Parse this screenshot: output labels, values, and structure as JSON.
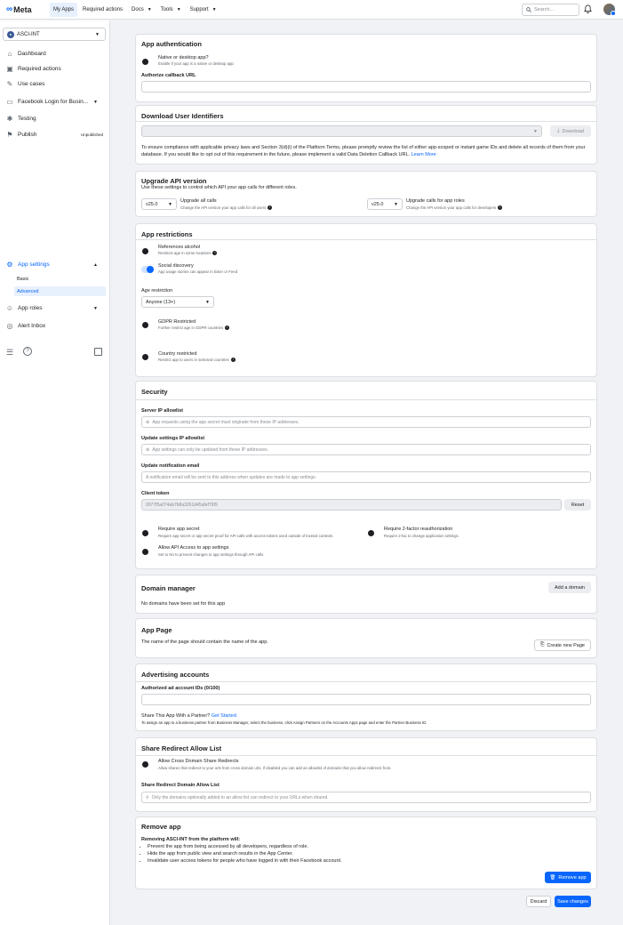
{
  "topbar": {
    "brand": "Meta",
    "nav": [
      {
        "label": "My Apps",
        "active": true,
        "caret": false
      },
      {
        "label": "Required actions",
        "active": false,
        "caret": false
      },
      {
        "label": "Docs",
        "active": false,
        "caret": true
      },
      {
        "label": "Tools",
        "active": false,
        "caret": true
      },
      {
        "label": "Support",
        "active": false,
        "caret": true
      }
    ],
    "search_placeholder": "Search..."
  },
  "sidebar": {
    "app_name": "ASCI-INT",
    "items": {
      "dashboard": "Dashboard",
      "required_actions": "Required actions",
      "use_cases": "Use cases",
      "facebook_login": "Facebook Login for Busin...",
      "testing": "Testing",
      "publish": "Publish",
      "publish_badge": "Unpublished",
      "app_settings": "App settings",
      "basic": "Basic",
      "advanced": "Advanced",
      "app_roles": "App roles",
      "alert_inbox": "Alert Inbox"
    }
  },
  "app_auth": {
    "title": "App authentication",
    "native_label": "Native or desktop app?",
    "native_sub": "Enable if your app is a native or desktop app",
    "callback_label": "Authorize callback URL"
  },
  "download_ids": {
    "title": "Download User Identifiers",
    "button": "Download",
    "text": "To ensure compliance with applicable privacy laws and Section 3(d)(i) of the Platform Terms, please promptly review the list of either app-scoped or instant game IDs and delete all records of them from your database. If you would like to opt out of this requirement in the future, please implement a valid Data Deletion Callback URL.",
    "learn_more": "Learn More"
  },
  "api_version": {
    "title": "Upgrade API version",
    "subtitle": "Use these settings to control which API your app calls for different roles.",
    "left_value": "v25.0",
    "left_label": "Upgrade all calls",
    "left_sub": "Change the API version your app calls for all users",
    "right_value": "v25.0",
    "right_label": "Upgrade calls for app roles",
    "right_sub": "Change the API version your app calls for developers"
  },
  "restrictions": {
    "title": "App restrictions",
    "alcohol_label": "References alcohol",
    "alcohol_sub": "Restricts age in some locations",
    "social_label": "Social discovery",
    "social_sub": "App usage stories can appear in ticker or Feed",
    "age_label": "Age restriction",
    "age_value": "Anyone (13+)",
    "gdpr_label": "GDPR Restricted",
    "gdpr_sub": "Further restrict age in GDPR countries",
    "country_label": "Country restricted",
    "country_sub": "Restrict app to users in selected countries"
  },
  "security": {
    "title": "Security",
    "server_ip_label": "Server IP allowlist",
    "server_ip_placeholder": "App requests using the app secret must originate from these IP addresses.",
    "update_ip_label": "Update settings IP allowlist",
    "update_ip_placeholder": "App settings can only be updated from these IP addresses.",
    "notif_email_label": "Update notification email",
    "notif_email_placeholder": "A notification email will be sent to this address when updates are made to app settings.",
    "client_token_label": "Client token",
    "client_token_value": "0077f5a074ab7b8a3261d45afef79f9",
    "reset_button": "Reset",
    "require_secret_label": "Require app secret",
    "require_secret_sub": "Require app secret or app secret proof for API calls with access tokens used outside of trusted contexts",
    "require_2fa_label": "Require 2-factor reauthorization",
    "require_2fa_sub": "Require 2-fac to change application settings",
    "allow_api_label": "Allow API Access to app settings",
    "allow_api_sub": "Set to No to prevent changes to app settings through API calls"
  },
  "domain": {
    "title": "Domain manager",
    "add_button": "Add a domain",
    "empty_text": "No domains have been set for this app"
  },
  "app_page": {
    "title": "App Page",
    "text": "The name of the page should contain the name of the app.",
    "create_button": "Create new Page"
  },
  "ad_accounts": {
    "title": "Advertising accounts",
    "ids_label": "Authorized ad account IDs (0/100)",
    "share_text": "Share This App With a Partner?",
    "get_started": "Get Started",
    "share_sub": "To assign an app to a business partner from Business Manager, select the business, click Assign Partners on the Accounts Apps page and enter the Partner Business ID."
  },
  "redirect": {
    "title": "Share Redirect Allow List",
    "toggle_label": "Allow Cross Domain Share Redirects",
    "toggle_sub": "Allow shares that redirect to your urls from cross domain urls. If disabled you can add an allowlist of domains that you allow redirects from.",
    "list_label": "Share Redirect Domain Allow List",
    "list_placeholder": "Only the domains optionally added to an allow list can redirect to your URLs when shared."
  },
  "remove": {
    "title": "Remove app",
    "lead": "Removing ASCI-INT from the platform will:",
    "bullets": [
      "Prevent the app from being accessed by all developers, regardless of role.",
      "Hide the app from public view and search results in the App Center.",
      "Invalidate user access tokens for people who have logged in with their Facebook account."
    ],
    "button": "Remove app"
  },
  "footer": {
    "discard": "Discard",
    "save": "Save changes"
  }
}
